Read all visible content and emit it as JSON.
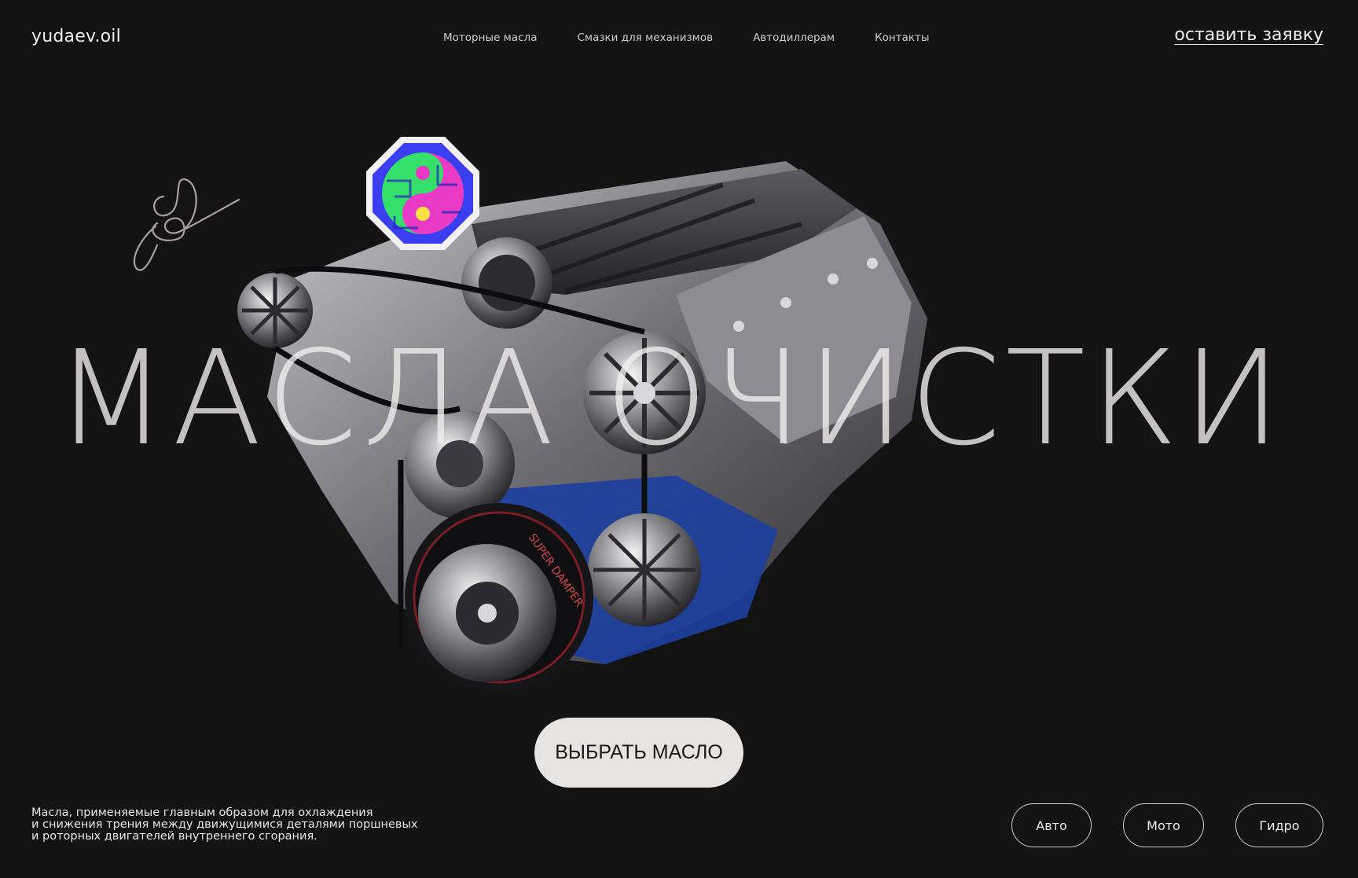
{
  "header": {
    "logo": "yudaev.oil",
    "nav": [
      "Моторные масла",
      "Смазки для механизмов",
      "Автодиллерам",
      "Контакты"
    ],
    "cta": "оставить заявку"
  },
  "hero": {
    "title": "МАСЛА ОЧИСТКИ",
    "button": "ВЫБРАТЬ МАСЛО",
    "engine_stamp": "SUPER DAMPER"
  },
  "footer": {
    "description": [
      "Масла, применяемые главным образом для охлаждения",
      "и снижения трения между движущимися деталями поршневых",
      "и роторных двигателей внутреннего сгорания."
    ],
    "categories": [
      "Авто",
      "Мото",
      "Гидро"
    ]
  },
  "colors": {
    "background": "#141314",
    "text": "#e9e6e6",
    "button_bg": "#e6e3e3",
    "engine_blue": "#1c3f9e"
  }
}
